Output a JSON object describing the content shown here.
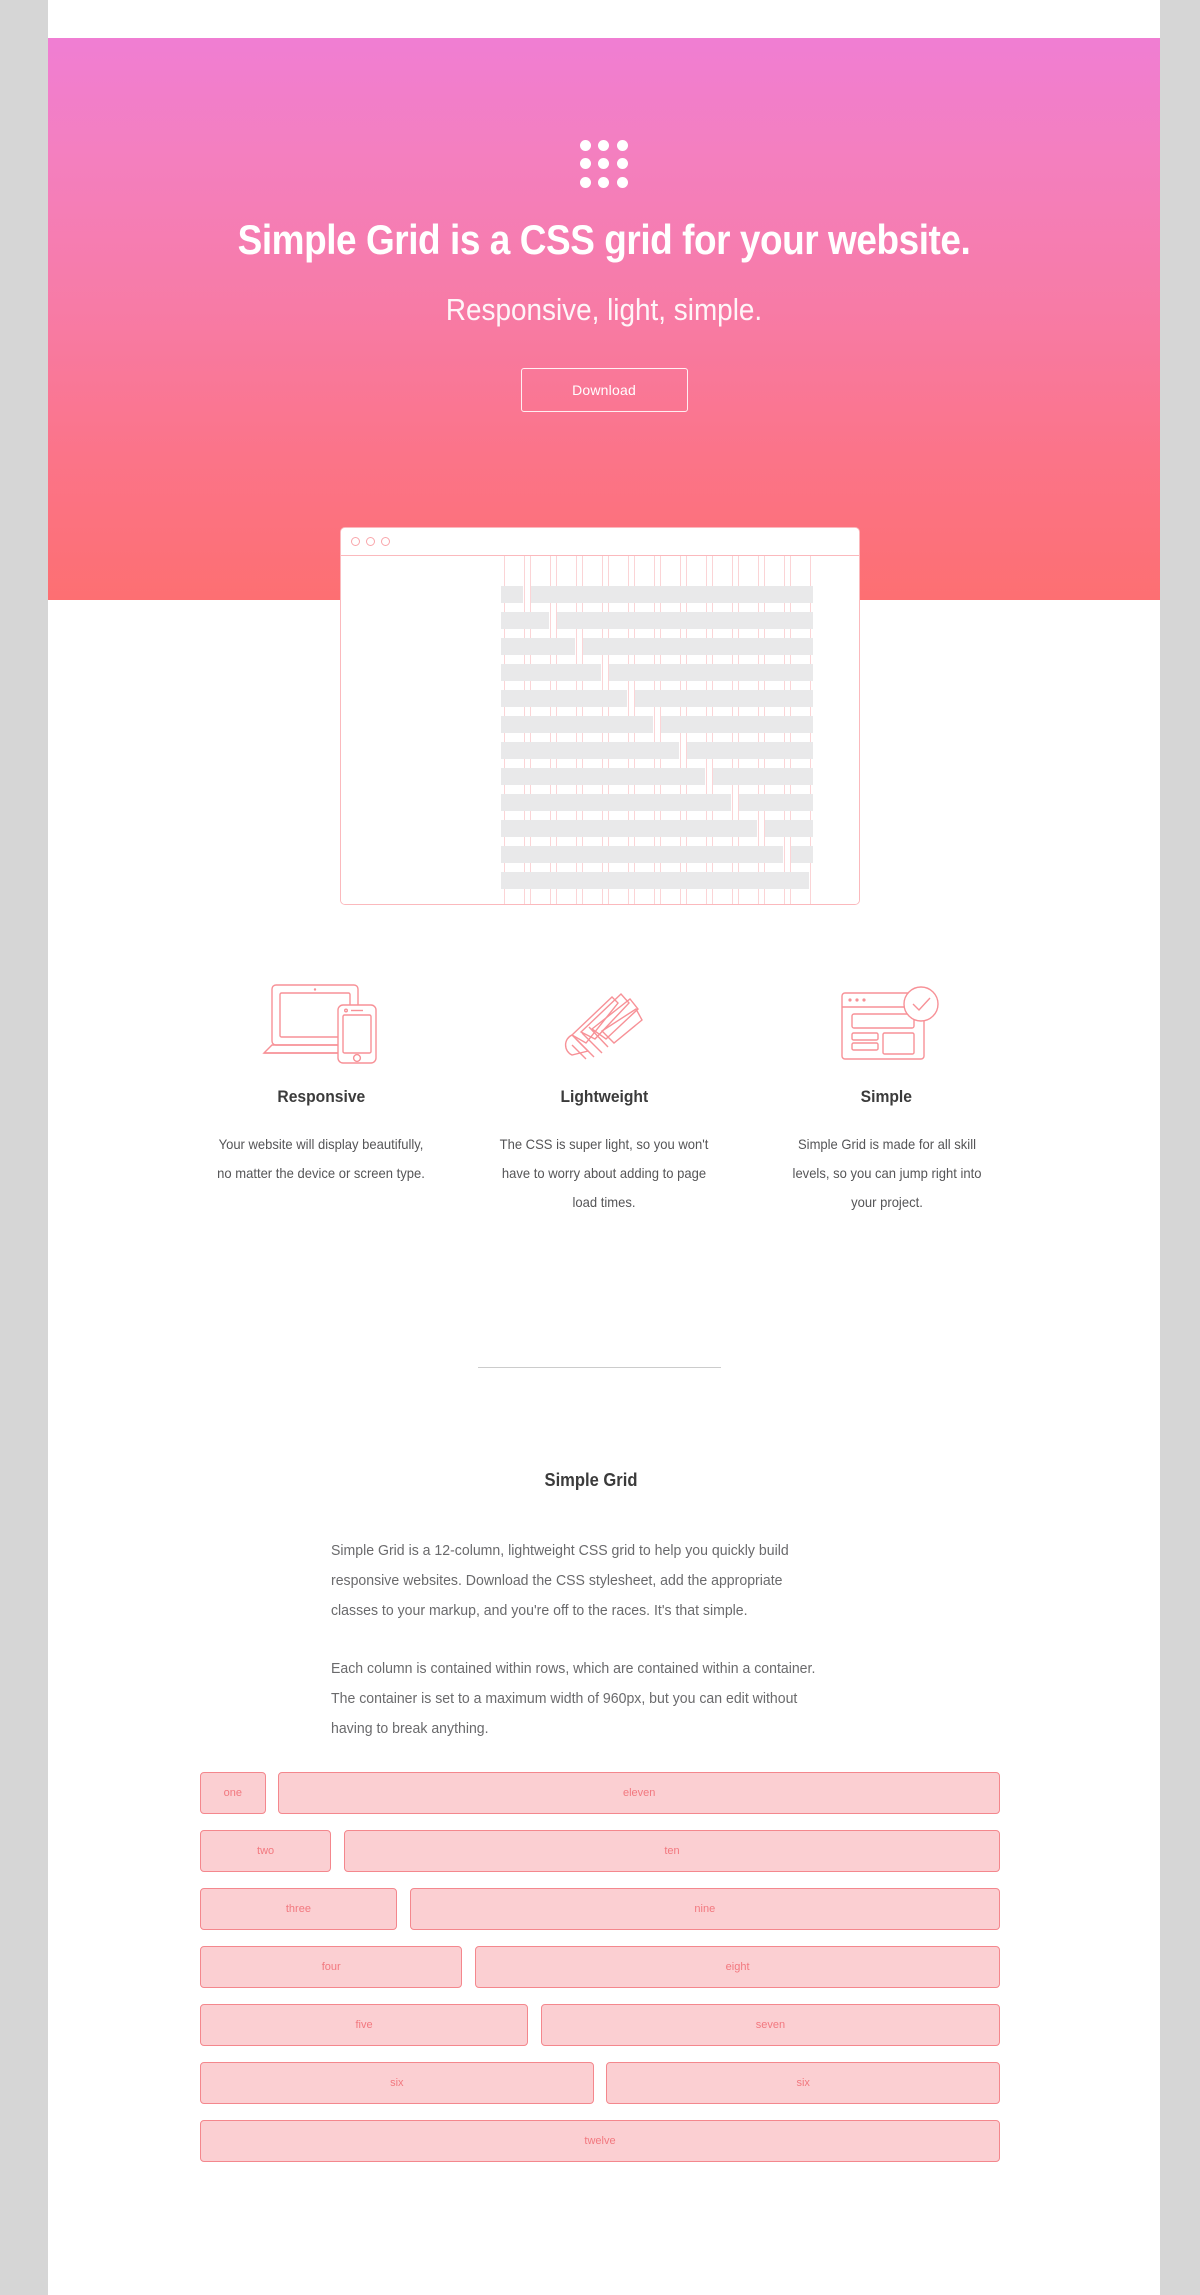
{
  "theme": {
    "gradient_top": "#f07ed3",
    "gradient_bottom": "#fd6f72",
    "accent_pink": "#f4878d",
    "cell_fill": "#fbcfd2",
    "page_bg": "#d6d6d6"
  },
  "hero": {
    "logo_icon": "grid-dots-logo-icon",
    "title": "Simple Grid is a CSS grid for your website.",
    "subtitle": "Responsive, light, simple.",
    "download_label": "Download"
  },
  "mockup": {
    "window_dots": [
      "traffic-dot-1",
      "traffic-dot-2",
      "traffic-dot-3"
    ],
    "column_count": 12
  },
  "features": [
    {
      "icon": "laptop-phone-icon",
      "title": "Responsive",
      "description": "Your website will display beautifully, no matter the device or screen type."
    },
    {
      "icon": "shuttlecock-icon",
      "title": "Lightweight",
      "description": "The CSS is super light, so you won't have to worry about adding to page load times."
    },
    {
      "icon": "browser-check-icon",
      "title": "Simple",
      "description": "Simple Grid is made for all skill levels, so you can jump right into your project."
    }
  ],
  "article": {
    "title": "Simple Grid",
    "paragraph_1": "Simple Grid is a 12-column, lightweight CSS grid to help you quickly build responsive websites. Download the CSS stylesheet, add the appropriate classes to your markup, and you're off to the races. It's that simple.",
    "paragraph_2": "Each column is contained within rows, which are contained within a container. The container is set to a maximum width of 960px, but you can edit without having to break anything."
  },
  "grid_demo": {
    "rows": [
      [
        {
          "label": "one",
          "span": 1
        },
        {
          "label": "eleven",
          "span": 11
        }
      ],
      [
        {
          "label": "two",
          "span": 2
        },
        {
          "label": "ten",
          "span": 10
        }
      ],
      [
        {
          "label": "three",
          "span": 3
        },
        {
          "label": "nine",
          "span": 9
        }
      ],
      [
        {
          "label": "four",
          "span": 4
        },
        {
          "label": "eight",
          "span": 8
        }
      ],
      [
        {
          "label": "five",
          "span": 5
        },
        {
          "label": "seven",
          "span": 7
        }
      ],
      [
        {
          "label": "six",
          "span": 6
        },
        {
          "label": "six",
          "span": 6
        }
      ],
      [
        {
          "label": "twelve",
          "span": 12
        }
      ]
    ]
  }
}
